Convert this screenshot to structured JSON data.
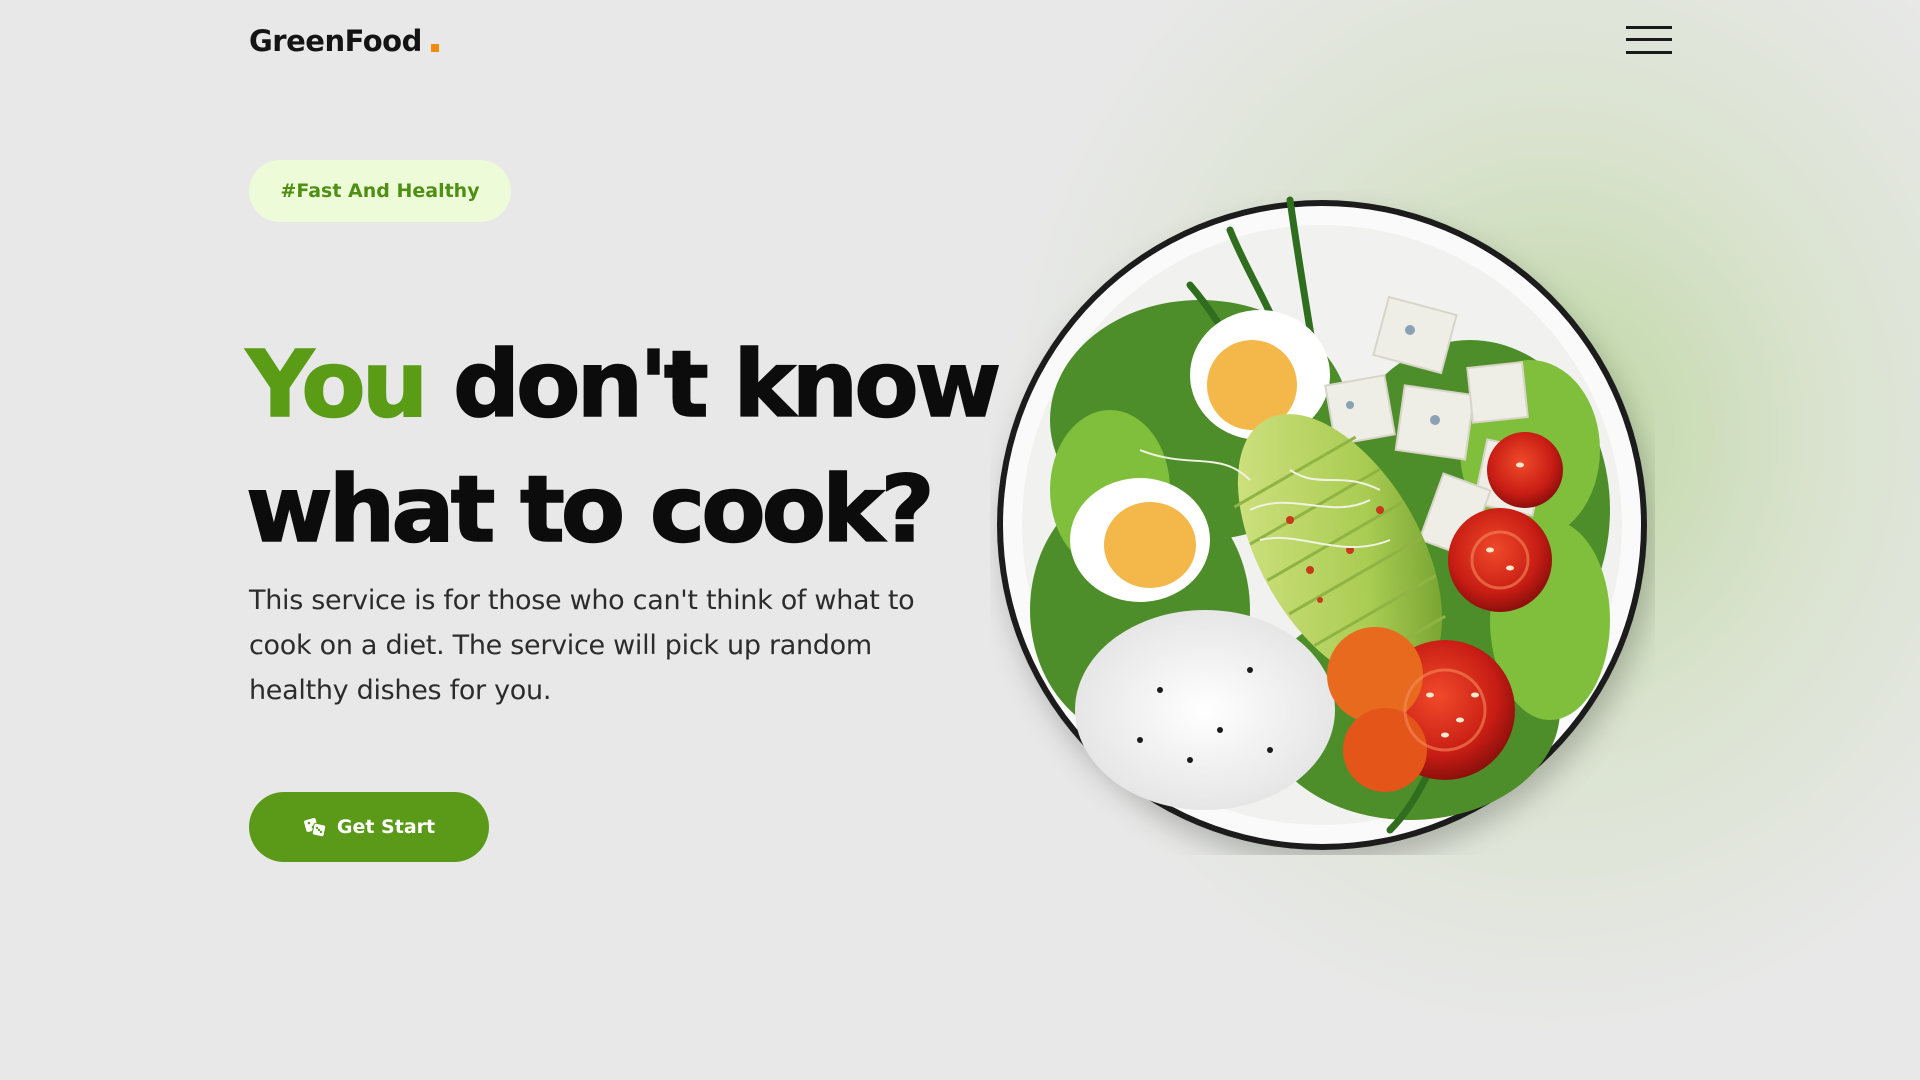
{
  "header": {
    "logo_text": "GreenFood",
    "menu_icon": "hamburger-menu-icon"
  },
  "hero": {
    "badge": "#Fast And Healthy",
    "headline_accent": "You",
    "headline_rest_line1": "don't know",
    "headline_line2": "what to cook?",
    "description": "This service is for those who can't think of what to cook on a diet. The service will pick up random healthy dishes for you.",
    "cta_label": "Get Start",
    "cta_icon": "dice-icon"
  },
  "image": {
    "subject": "salad-bowl"
  },
  "colors": {
    "accent_green": "#5b9a18",
    "badge_bg": "#eefbd8",
    "logo_dot": "#f08a12",
    "background": "#e8e8e8"
  }
}
